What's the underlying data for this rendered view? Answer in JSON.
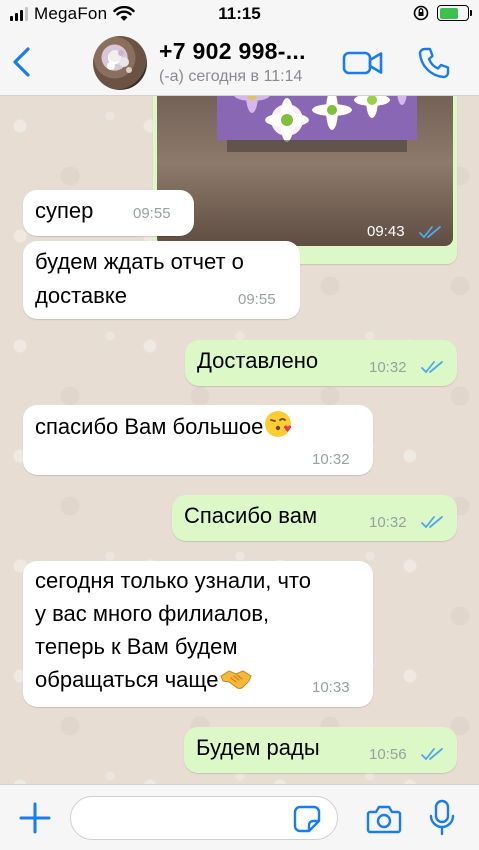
{
  "status_bar": {
    "carrier": "MegaFon",
    "time": "11:15"
  },
  "header": {
    "contact_name": "+7 902 998-...",
    "contact_status": "(-а) сегодня в 11:14"
  },
  "image_message": {
    "time": "09:43",
    "status": "read"
  },
  "messages": [
    {
      "direction": "in",
      "text": "супер",
      "time": "09:55"
    },
    {
      "direction": "in",
      "lines": [
        "будем ждать отчет о",
        "доставке"
      ],
      "time": "09:55"
    },
    {
      "direction": "out",
      "text": "Доставлено",
      "time": "10:32",
      "status": "read"
    },
    {
      "direction": "in",
      "text": "спасибо Вам большое",
      "emoji": "face-blowing-kiss",
      "time": "10:32"
    },
    {
      "direction": "out",
      "text": "Спасибо вам",
      "time": "10:32",
      "status": "read"
    },
    {
      "direction": "in",
      "lines": [
        "сегодня только узнали, что",
        "у вас много филиалов,",
        "теперь к Вам будем",
        "обращаться чаще"
      ],
      "emoji": "handshake",
      "time": "10:33"
    },
    {
      "direction": "out",
      "text": "Будем рады",
      "time": "10:56",
      "status": "read"
    }
  ],
  "composer": {
    "value": "",
    "placeholder": ""
  },
  "colors": {
    "chat_background": "#e7ddd3",
    "outgoing_bubble": "#dcf8c6",
    "incoming_bubble": "#ffffff",
    "accent_blue": "#1a7cf5",
    "read_ticks": "#4fa9e8"
  },
  "icons": {
    "back": "chevron-left-icon",
    "video": "video-camera-icon",
    "call": "phone-icon",
    "plus": "plus-icon",
    "sticker": "sticker-icon",
    "camera": "camera-icon",
    "mic": "microphone-icon"
  }
}
